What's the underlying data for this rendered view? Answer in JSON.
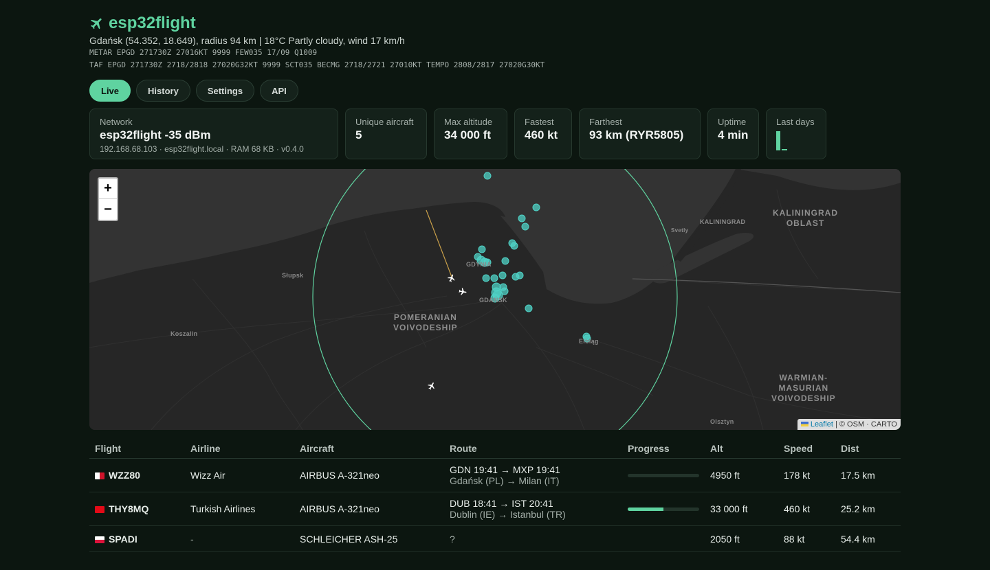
{
  "header": {
    "title": "esp32flight",
    "subtitle": "Gdańsk (54.352, 18.649), radius 94 km  |  18°C Partly cloudy, wind 17 km/h",
    "metar": "METAR EPGD 271730Z 27016KT 9999 FEW035 17/09 Q1009",
    "taf": "TAF EPGD 271730Z 2718/2818 27020G32KT 9999 SCT035 BECMG 2718/2721 27010KT TEMPO 2808/2817 27020G30KT"
  },
  "tabs": [
    {
      "label": "Live",
      "active": true
    },
    {
      "label": "History",
      "active": false
    },
    {
      "label": "Settings",
      "active": false
    },
    {
      "label": "API",
      "active": false
    }
  ],
  "cards": {
    "network": {
      "label": "Network",
      "value": "esp32flight -35 dBm",
      "detail": "192.168.68.103 · esp32flight.local · RAM 68 KB · v0.4.0"
    },
    "unique": {
      "label": "Unique aircraft",
      "value": "5"
    },
    "max_alt": {
      "label": "Max altitude",
      "value": "34 000 ft"
    },
    "fastest": {
      "label": "Fastest",
      "value": "460 kt"
    },
    "farthest": {
      "label": "Farthest",
      "value": "93 km (RYR5805)"
    },
    "uptime": {
      "label": "Uptime",
      "value": "4 min"
    },
    "last_days": {
      "label": "Last days"
    }
  },
  "map": {
    "zoom_in": "+",
    "zoom_out": "−",
    "attribution_leaflet": "Leaflet",
    "attribution_rest": " | © OSM · CARTO",
    "labels": {
      "kaliningrad": "KALININGRAD",
      "kaliningrad_oblast_1": "KALININGRAD",
      "kaliningrad_oblast_2": "OBLAST",
      "svetly": "Svetly",
      "slupsk": "Słupsk",
      "gdynia": "GDYNIA",
      "gdansk": "GDAŃSK",
      "pomeranian_1": "POMERANIAN",
      "pomeranian_2": "VOIVODESHIP",
      "koszalin": "Koszalin",
      "elblag": "Elbląg",
      "warmian_1": "WARMIAN-",
      "warmian_2": "MASURIAN",
      "warmian_3": "VOIVODESHIP",
      "olsztyn": "Olsztyn"
    },
    "colors": {
      "range_ring": "#5fd3a0",
      "marker": "#4fd1c5",
      "track": "#c9a04a"
    }
  },
  "table": {
    "headers": [
      "Flight",
      "Airline",
      "Aircraft",
      "Route",
      "Progress",
      "Alt",
      "Speed",
      "Dist"
    ],
    "rows": [
      {
        "flag": "malta",
        "flight": "WZZ80",
        "airline": "Wizz Air",
        "aircraft": "AIRBUS A-321neo",
        "route": "GDN 19:41 → MXP 19:41",
        "route_sub": "Gdańsk (PL) → Milan (IT)",
        "progress": 0.0,
        "alt": "4950 ft",
        "speed": "178 kt",
        "dist": "17.5 km"
      },
      {
        "flag": "turkey",
        "flight": "THY8MQ",
        "airline": "Turkish Airlines",
        "aircraft": "AIRBUS A-321neo",
        "route": "DUB 18:41 → IST 20:41",
        "route_sub": "Dublin (IE) → Istanbul (TR)",
        "progress": 0.5,
        "alt": "33 000 ft",
        "speed": "460 kt",
        "dist": "25.2 km"
      },
      {
        "flag": "poland",
        "flight": "SPADI",
        "airline": "-",
        "aircraft": "SCHLEICHER ASH-25",
        "route": "?",
        "route_sub": "",
        "progress": null,
        "alt": "2050 ft",
        "speed": "88 kt",
        "dist": "54.4 km"
      }
    ]
  }
}
